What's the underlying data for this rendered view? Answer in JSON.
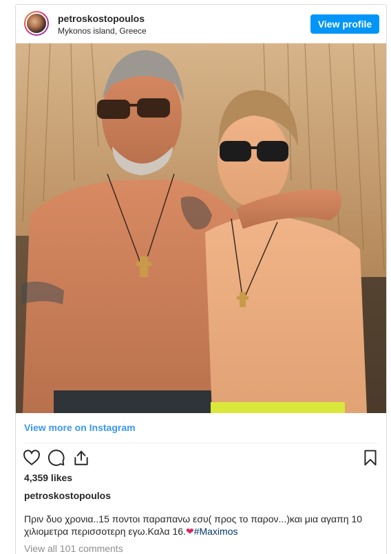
{
  "header": {
    "username": "petroskostopoulos",
    "location": "Mykonos island, Greece",
    "view_profile_label": "View profile"
  },
  "post": {
    "view_more_label": "View more on Instagram",
    "likes": "4,359 likes",
    "caption_username": "petroskostopoulos",
    "caption_text": "Πριν δυο χρονια..15 ποντοι παραπανω εσυ( προς το παρον...)και μια αγαπη 10 χιλιομετρα περισσοτερη εγω.Καλα 16.",
    "caption_emoji": "❤",
    "caption_hashtag": "#Maximos",
    "view_comments_label": "View all 101 comments"
  },
  "icons": {
    "like": "heart-icon",
    "comment": "comment-icon",
    "share": "share-icon",
    "save": "bookmark-icon"
  },
  "colors": {
    "accent": "#0095f6",
    "link": "#3897f0",
    "hashtag": "#00376b",
    "muted": "#8e8e8e"
  }
}
